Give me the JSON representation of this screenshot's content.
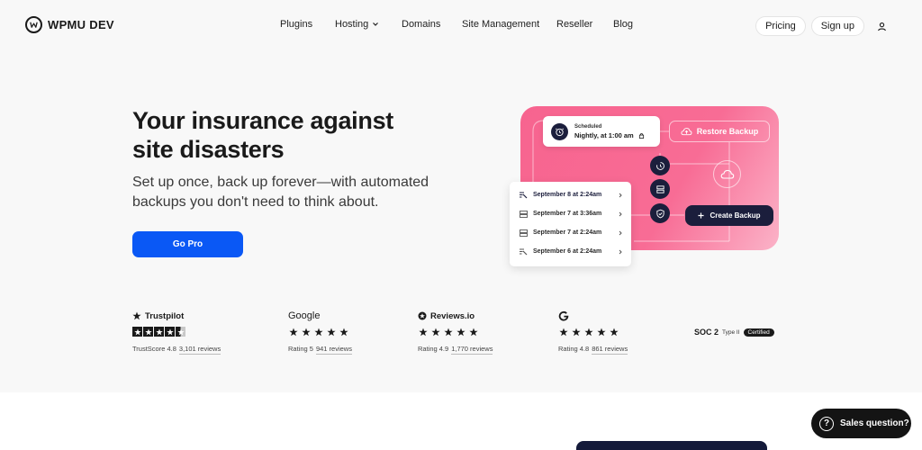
{
  "brand": {
    "name": "WPMU DEV"
  },
  "nav": [
    {
      "label": "Plugins"
    },
    {
      "label": "Hosting"
    },
    {
      "label": "Domains"
    },
    {
      "label": "Site Management"
    },
    {
      "label": "Reseller"
    },
    {
      "label": "Blog"
    }
  ],
  "header": {
    "pricing": "Pricing",
    "signup": "Sign up"
  },
  "hero": {
    "title": "Your insurance against site disasters",
    "subtitle": "Set up once, back up forever—with automated backups you don't need to think about.",
    "cta": "Go Pro"
  },
  "illustration": {
    "scheduled_label": "Scheduled",
    "scheduled_value": "Nightly, at 1:00 am",
    "restore": "Restore Backup",
    "create": "Create Backup",
    "backups": [
      {
        "label": "September 8 at 2:24am",
        "icon": "hosting-backup-icon"
      },
      {
        "label": "September 7 at 3:36am",
        "icon": "server-icon"
      },
      {
        "label": "September 7 at 2:24am",
        "icon": "server-icon"
      },
      {
        "label": "September 6 at 2:24am",
        "icon": "hosting-backup-icon"
      }
    ],
    "colors": {
      "card": "#f7648f",
      "dark": "#1b1e3c"
    }
  },
  "reviews": [
    {
      "brand": "Trustpilot",
      "score_label": "TrustScore 4.8",
      "count": "3,101 reviews"
    },
    {
      "brand": "Google",
      "score_label": "Rating 5",
      "count": "941 reviews"
    },
    {
      "brand": "Reviews.io",
      "score_label": "Rating 4.9",
      "count": "1,770 reviews"
    },
    {
      "brand": "",
      "score_label": "Rating 4.8",
      "count": "861 reviews"
    }
  ],
  "soc": {
    "name": "SOC 2",
    "type": "Type II",
    "badge": "Certified"
  },
  "chat": {
    "label": "Sales question?"
  },
  "colors": {
    "primary": "#0a58f5",
    "background": "#f8f8f8"
  }
}
